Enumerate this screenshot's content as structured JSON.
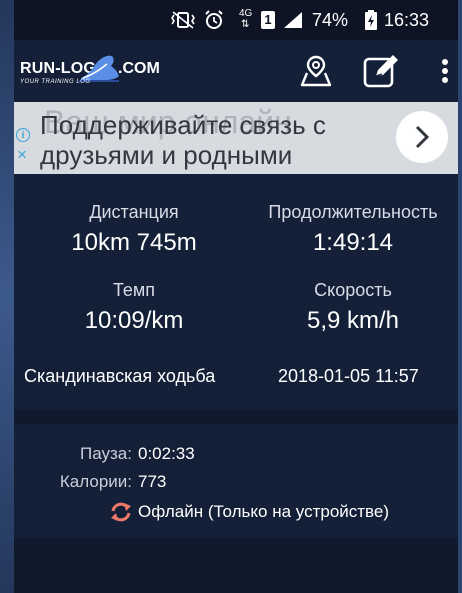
{
  "status_bar": {
    "battery": "74%",
    "time": "16:33",
    "network": "4G",
    "sim_slot": "1"
  },
  "app_bar": {
    "logo_main": "RUN-LOG",
    "logo_suffix": ".COM",
    "logo_tagline": "YOUR TRAINING LOG",
    "icons": [
      "map-pin-icon",
      "edit-icon",
      "more-icon"
    ]
  },
  "ad": {
    "text": "Поддерживайте связь с друзьями и родными",
    "background_text": "Ваш мир онлайн",
    "info_glyph": "i",
    "close_glyph": "×"
  },
  "stats": {
    "distance": {
      "label": "Дистанция",
      "value": "10km 745m"
    },
    "duration": {
      "label": "Продолжительность",
      "value": "1:49:14"
    },
    "pace": {
      "label": "Темп",
      "value": "10:09/km"
    },
    "speed": {
      "label": "Скорость",
      "value": "5,9 km/h"
    },
    "activity_type": "Скандинавская ходьба",
    "datetime": "2018-01-05 11:57"
  },
  "details": {
    "pause_label": "Пауза:",
    "pause_value": "0:02:33",
    "calories_label": "Калории:",
    "calories_value": "773",
    "sync_status": "Офлайн (Только на устройстве)"
  },
  "colors": {
    "background": "#0f1a2d",
    "panel": "#142038",
    "sync_icon": "#f07a6a",
    "ad_accent": "#3aa3d6"
  }
}
